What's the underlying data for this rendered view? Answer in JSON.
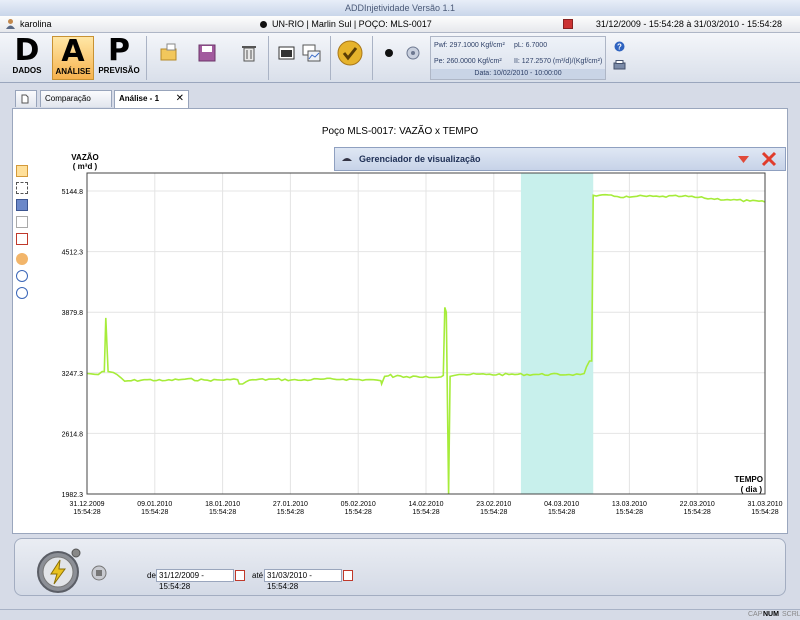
{
  "window": {
    "title": "ADDInjetividade Versão 1.1"
  },
  "infobar": {
    "user": "karolina",
    "well_info": "UN-RIO | Marlin Sul | POÇO: MLS-0017",
    "period": "31/12/2009 - 15:54:28  à  31/03/2010 - 15:54:28"
  },
  "ribbon": {
    "modules": [
      {
        "letter": "D",
        "label": "DADOS"
      },
      {
        "letter": "A",
        "label": "ANÁLISE"
      },
      {
        "letter": "P",
        "label": "PREVISÃO"
      }
    ],
    "params": {
      "pwf": "Pwf: 297.1000 Kgf/cm²",
      "pe": "Pe: 260.0000 Kgf/cm²",
      "pl": "pL: 6.7000",
      "ii": "II: 127.2570 (m³/d)/(Kgf/cm²)",
      "date": "Data: 10/02/2010 - 10:00:00"
    }
  },
  "tabs": [
    {
      "label": ""
    },
    {
      "label": "Comparação"
    },
    {
      "label": "Análise - 1"
    }
  ],
  "gerenciador": {
    "label": "Gerenciador de visualização"
  },
  "bottom": {
    "de_label": "de",
    "de_value": "31/12/2009 - 15:54:28",
    "ate_label": "até",
    "ate_value": "31/03/2010 - 15:54:28"
  },
  "status": {
    "cap": "CAP",
    "num": "NUM",
    "scrl": "SCRL"
  },
  "chart_data": {
    "type": "line",
    "title": "Poço MLS-0017: VAZÃO  x TEMPO",
    "ylabel": "VAZÃO",
    "ylabel_units": "( m³d )",
    "xlabel": "TEMPO",
    "xlabel_units": "( dia )",
    "ylim": [
      1982.3,
      5144.8
    ],
    "yticks": [
      "5144.8",
      "4512.3",
      "3879.8",
      "3247.3",
      "2614.8",
      "1982.3"
    ],
    "xticks": [
      {
        "date": "31.12.2009",
        "time": "15:54:28"
      },
      {
        "date": "09.01.2010",
        "time": "15:54:28"
      },
      {
        "date": "18.01.2010",
        "time": "15:54:28"
      },
      {
        "date": "27.01.2010",
        "time": "15:54:28"
      },
      {
        "date": "05.02.2010",
        "time": "15:54:28"
      },
      {
        "date": "14.02.2010",
        "time": "15:54:28"
      },
      {
        "date": "23.02.2010",
        "time": "15:54:28"
      },
      {
        "date": "04.03.2010",
        "time": "15:54:28"
      },
      {
        "date": "13.03.2010",
        "time": "15:54:28"
      },
      {
        "date": "22.03.2010",
        "time": "15:54:28"
      },
      {
        "date": "31.03.2010",
        "time": "15:54:28"
      }
    ],
    "grid": true,
    "line_color": "#a6ec3a",
    "highlight_color": "#c8f0ec",
    "highlight_day_range": [
      57.6,
      67.2
    ],
    "series": [
      {
        "x_days": [
          0,
          1.5,
          2.0,
          2.3,
          2.5,
          2.8,
          3.5,
          5,
          8,
          10,
          13,
          16,
          19,
          20,
          20.2,
          22,
          25,
          28,
          31,
          34,
          37,
          38,
          39,
          39.1,
          39.5,
          40,
          40.3,
          40.6,
          41.2,
          42,
          45,
          47,
          47.3,
          47.5,
          47.7,
          48.0,
          48.2,
          48.8,
          49.4,
          50,
          53,
          56,
          60,
          64,
          65.5,
          66,
          66.3,
          66.7,
          67.0,
          67.2,
          68,
          70,
          72,
          73,
          76,
          79,
          82,
          85,
          88,
          90
        ],
        "values": [
          3240,
          3230,
          3260,
          3260,
          3820,
          3260,
          3250,
          3160,
          3175,
          3165,
          3180,
          3170,
          3175,
          3175,
          3130,
          3175,
          3180,
          3170,
          3180,
          3180,
          3175,
          3175,
          3165,
          3130,
          3210,
          3215,
          3230,
          3200,
          3220,
          3200,
          3210,
          3205,
          3220,
          3930,
          3880,
          1982.3,
          3210,
          3220,
          3230,
          3230,
          3230,
          3230,
          3230,
          3230,
          3230,
          3240,
          3310,
          3370,
          3370,
          5100,
          5100,
          5090,
          5080,
          5090,
          5085,
          5090,
          5070,
          5055,
          5040,
          5030
        ]
      }
    ]
  }
}
